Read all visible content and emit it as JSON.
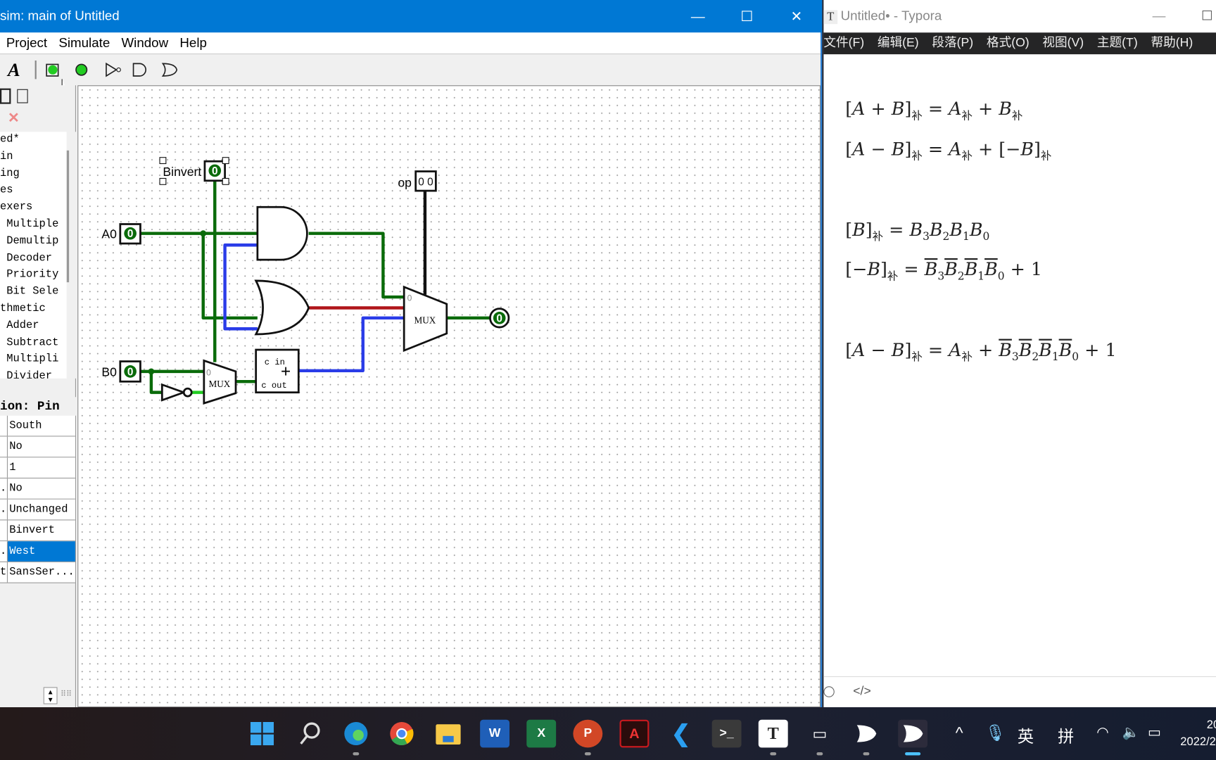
{
  "logisim": {
    "title": "sim: main of Untitled",
    "menu": [
      "Project",
      "Simulate",
      "Window",
      "Help"
    ],
    "toolbar_icons": [
      "text-tool-icon",
      "input-pin-icon",
      "output-pin-icon",
      "not-gate-icon",
      "and-gate-icon",
      "or-gate-icon"
    ],
    "tree": [
      "ed*",
      "in",
      "ing",
      "es",
      "exers",
      " Multiple",
      " Demultip",
      " Decoder",
      " Priority",
      " Bit Sele",
      "thmetic",
      " Adder",
      " Subtract",
      " Multipli",
      " Divider"
    ],
    "props_title": "ion: Pin",
    "props": [
      {
        "k": "",
        "v": "South"
      },
      {
        "k": "",
        "v": "No"
      },
      {
        "k": "",
        "v": "1"
      },
      {
        "k": ".",
        "v": "No"
      },
      {
        "k": ".",
        "v": "Unchanged"
      },
      {
        "k": "",
        "v": "Binvert"
      },
      {
        "k": ".",
        "v": "West",
        "selected": true
      },
      {
        "k": "t",
        "v": "SansSer..."
      }
    ],
    "circuit": {
      "pins": {
        "binvert": "Binvert",
        "a0": "A0",
        "b0": "B0",
        "op": "op"
      },
      "values": {
        "binvert": "0",
        "a0": "0",
        "b0": "0",
        "op": "0 0",
        "out": "0"
      },
      "mux_label": "MUX",
      "mux_in0": "0",
      "adder_cin": "c in",
      "adder_cout": "c out",
      "adder_sym": "+"
    },
    "colors": {
      "wire_green": "#0a6b0a",
      "wire_blue": "#2a3ce8",
      "wire_red": "#b0161a",
      "titlebar": "#0078d4"
    }
  },
  "typora": {
    "title": "Untitled• - Typora",
    "menu": [
      "文件(F)",
      "编辑(E)",
      "段落(P)",
      "格式(O)",
      "视图(V)",
      "主题(T)",
      "帮助(H)"
    ],
    "formulas": {
      "sub": "补"
    },
    "footer": {
      "source_icon": "</>"
    }
  },
  "taskbar": {
    "apps": [
      "start",
      "search",
      "edge",
      "chrome",
      "explorer",
      "word",
      "excel",
      "powerpoint",
      "acrobat",
      "vscode",
      "terminal",
      "typora",
      "camera",
      "logisim",
      "logisim-active"
    ],
    "tray": {
      "ime1": "英",
      "ime2": "拼",
      "clock_top": "20",
      "clock_date": "2022/2"
    }
  }
}
